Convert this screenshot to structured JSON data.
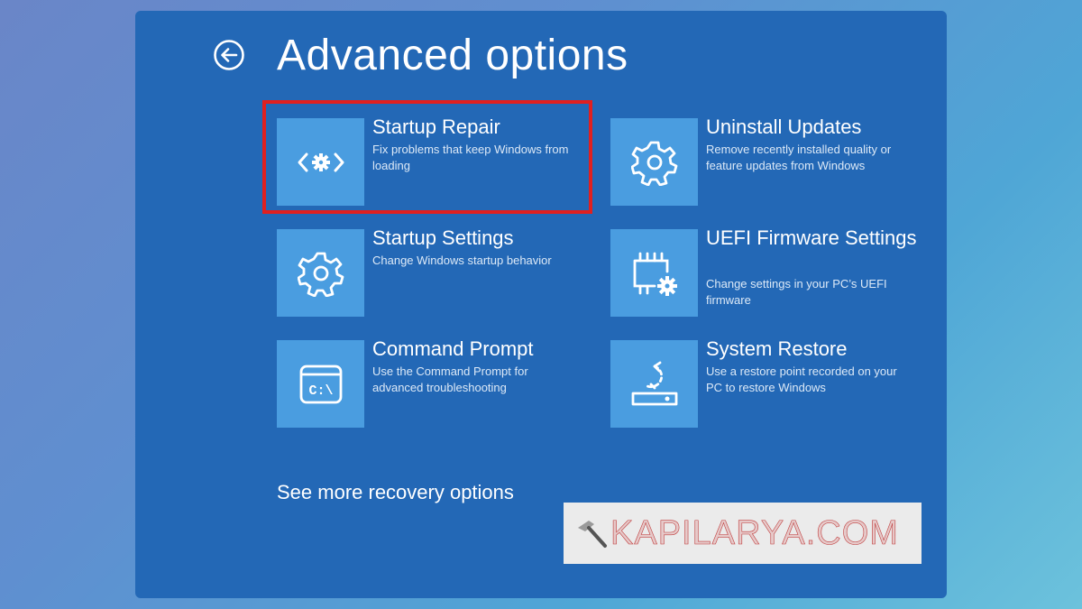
{
  "header": {
    "title": "Advanced options",
    "back_icon": "back-arrow-circle-icon"
  },
  "options": [
    {
      "title": "Startup Repair",
      "description": "Fix problems that keep Windows from loading",
      "icon": "startup-repair-icon",
      "highlighted": true
    },
    {
      "title": "Uninstall Updates",
      "description": "Remove recently installed quality or feature updates from Windows",
      "icon": "gear-icon"
    },
    {
      "title": "Startup Settings",
      "description": "Change Windows startup behavior",
      "icon": "gear-icon"
    },
    {
      "title": "UEFI Firmware Settings",
      "description": "Change settings in your PC’s UEFI firmware",
      "icon": "chip-gear-icon"
    },
    {
      "title": "Command Prompt",
      "description": "Use the Command Prompt for advanced troubleshooting",
      "icon": "command-prompt-icon",
      "icon_text": "C:\\"
    },
    {
      "title": "System Restore",
      "description": "Use a restore point recorded on your PC to restore Windows",
      "icon": "system-restore-icon"
    }
  ],
  "more_link": "See more recovery options",
  "watermark": {
    "text": "KAPILARYA.COM",
    "icon": "hammer-icon"
  },
  "colors": {
    "panel": "#2368b6",
    "tile_icon_bg": "#4a9de0",
    "highlight": "#e02020"
  }
}
